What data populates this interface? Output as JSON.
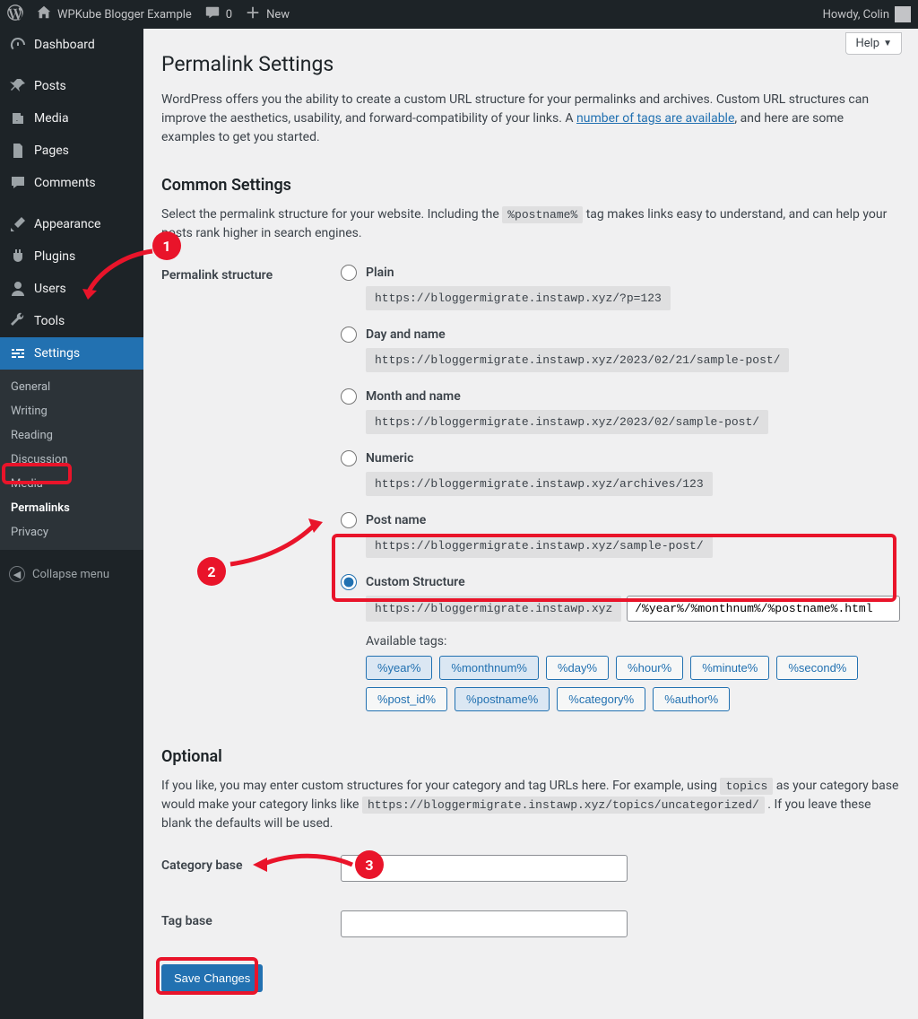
{
  "adminbar": {
    "site_name": "WPKube Blogger Example",
    "comments_count": "0",
    "new_label": "New",
    "howdy": "Howdy, Colin"
  },
  "sidebar": {
    "items": [
      {
        "label": "Dashboard"
      },
      {
        "label": "Posts"
      },
      {
        "label": "Media"
      },
      {
        "label": "Pages"
      },
      {
        "label": "Comments"
      },
      {
        "label": "Appearance"
      },
      {
        "label": "Plugins"
      },
      {
        "label": "Users"
      },
      {
        "label": "Tools"
      },
      {
        "label": "Settings"
      }
    ],
    "submenu": [
      {
        "label": "General"
      },
      {
        "label": "Writing"
      },
      {
        "label": "Reading"
      },
      {
        "label": "Discussion"
      },
      {
        "label": "Media"
      },
      {
        "label": "Permalinks"
      },
      {
        "label": "Privacy"
      }
    ],
    "collapse": "Collapse menu"
  },
  "content": {
    "help": "Help",
    "title": "Permalink Settings",
    "intro_1": "WordPress offers you the ability to create a custom URL structure for your permalinks and archives. Custom URL structures can improve the aesthetics, usability, and forward-compatibility of your links. A ",
    "intro_link": "number of tags are available",
    "intro_2": ", and here are some examples to get you started.",
    "common_heading": "Common Settings",
    "common_desc_1": "Select the permalink structure for your website. Including the ",
    "common_code": "%postname%",
    "common_desc_2": " tag makes links easy to understand, and can help your posts rank higher in search engines.",
    "structure_label": "Permalink structure",
    "options": [
      {
        "label": "Plain",
        "example": "https://bloggermigrate.instawp.xyz/?p=123"
      },
      {
        "label": "Day and name",
        "example": "https://bloggermigrate.instawp.xyz/2023/02/21/sample-post/"
      },
      {
        "label": "Month and name",
        "example": "https://bloggermigrate.instawp.xyz/2023/02/sample-post/"
      },
      {
        "label": "Numeric",
        "example": "https://bloggermigrate.instawp.xyz/archives/123"
      },
      {
        "label": "Post name",
        "example": "https://bloggermigrate.instawp.xyz/sample-post/"
      },
      {
        "label": "Custom Structure"
      }
    ],
    "custom_base": "https://bloggermigrate.instawp.xyz",
    "custom_value": "/%year%/%monthnum%/%postname%.html",
    "available_tags_label": "Available tags:",
    "tags": [
      "%year%",
      "%monthnum%",
      "%day%",
      "%hour%",
      "%minute%",
      "%second%",
      "%post_id%",
      "%postname%",
      "%category%",
      "%author%"
    ],
    "active_tags": [
      "%year%",
      "%monthnum%",
      "%postname%"
    ],
    "optional_heading": "Optional",
    "optional_desc_a": "If you like, you may enter custom structures for your category and tag URLs here. For example, using ",
    "optional_code_a": "topics",
    "optional_desc_b": " as your category base would make your category links like ",
    "optional_code_b": "https://bloggermigrate.instawp.xyz/topics/uncategorized/",
    "optional_desc_c": " . If you leave these blank the defaults will be used.",
    "category_base_label": "Category base",
    "tag_base_label": "Tag base",
    "save_button": "Save Changes"
  },
  "annotations": {
    "1": "1",
    "2": "2",
    "3": "3"
  }
}
